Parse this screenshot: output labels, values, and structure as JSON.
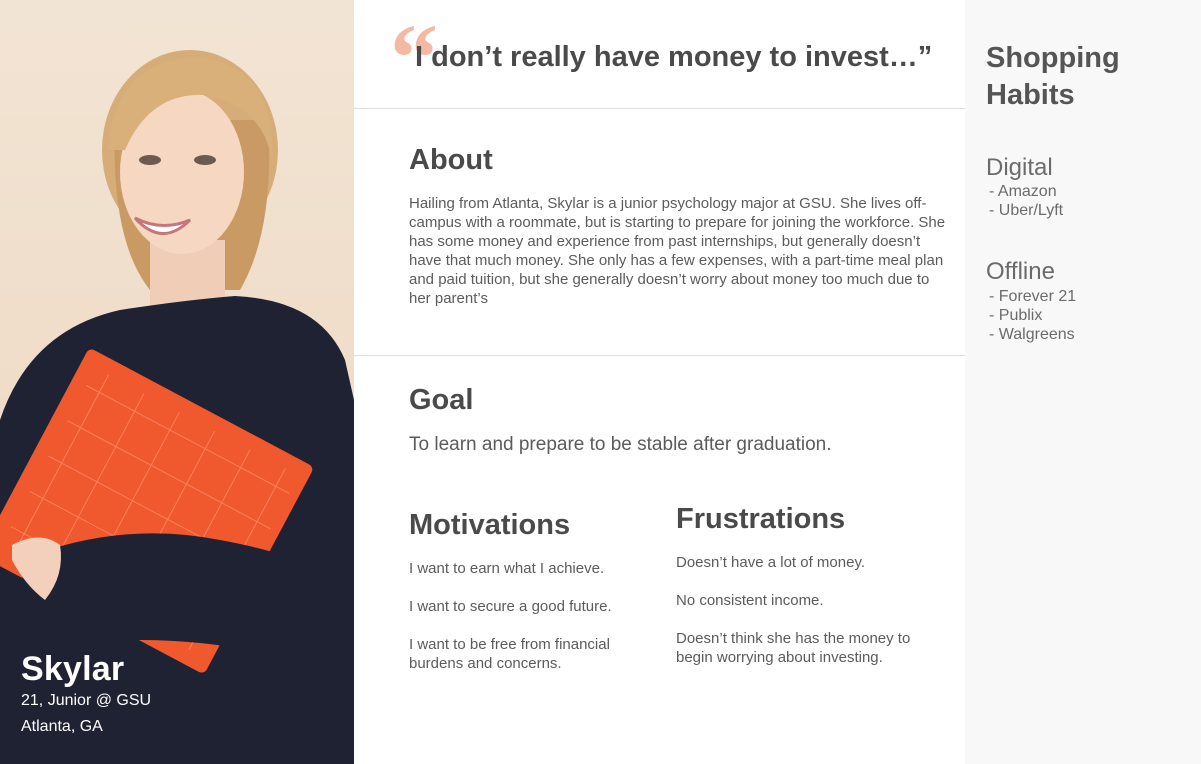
{
  "persona": {
    "name": "Skylar",
    "line1": "21, Junior @ GSU",
    "line2": "Atlanta, GA"
  },
  "quote": {
    "mark": "“",
    "text": "I don’t really have money to invest…”"
  },
  "about": {
    "title": "About",
    "text": "Hailing from Atlanta, Skylar is a junior psychology major at GSU. She lives off-campus with a roommate, but is starting to prepare for joining the workforce. She has some money and experience from past internships, but generally doesn’t have that much money. She only has a few expenses, with a part-time meal plan and paid tuition, but she generally doesn’t worry about money too much due to her parent’s"
  },
  "goal": {
    "title": "Goal",
    "text": "To learn and prepare to be stable after graduation."
  },
  "motivations": {
    "title": "Motivations",
    "items": [
      "I want to earn what I achieve.",
      "I want to secure a good future.",
      "I want to be free from financial burdens and concerns."
    ]
  },
  "frustrations": {
    "title": "Frustrations",
    "items": [
      "Doesn’t have a lot of money.",
      "No consistent income.",
      "Doesn’t think she has the money to begin worrying about investing."
    ]
  },
  "shopping": {
    "title": "Shopping Habits",
    "digital_label": "Digital",
    "digital": [
      "- Amazon",
      "- Uber/Lyft"
    ],
    "offline_label": "Offline",
    "offline": [
      "- Forever 21",
      "- Publix",
      "- Walgreens"
    ]
  },
  "colors": {
    "accent": "#f5b8a3",
    "folder": "#f0582e",
    "sweater": "#1f2233",
    "panel": "#f8f8f8"
  }
}
